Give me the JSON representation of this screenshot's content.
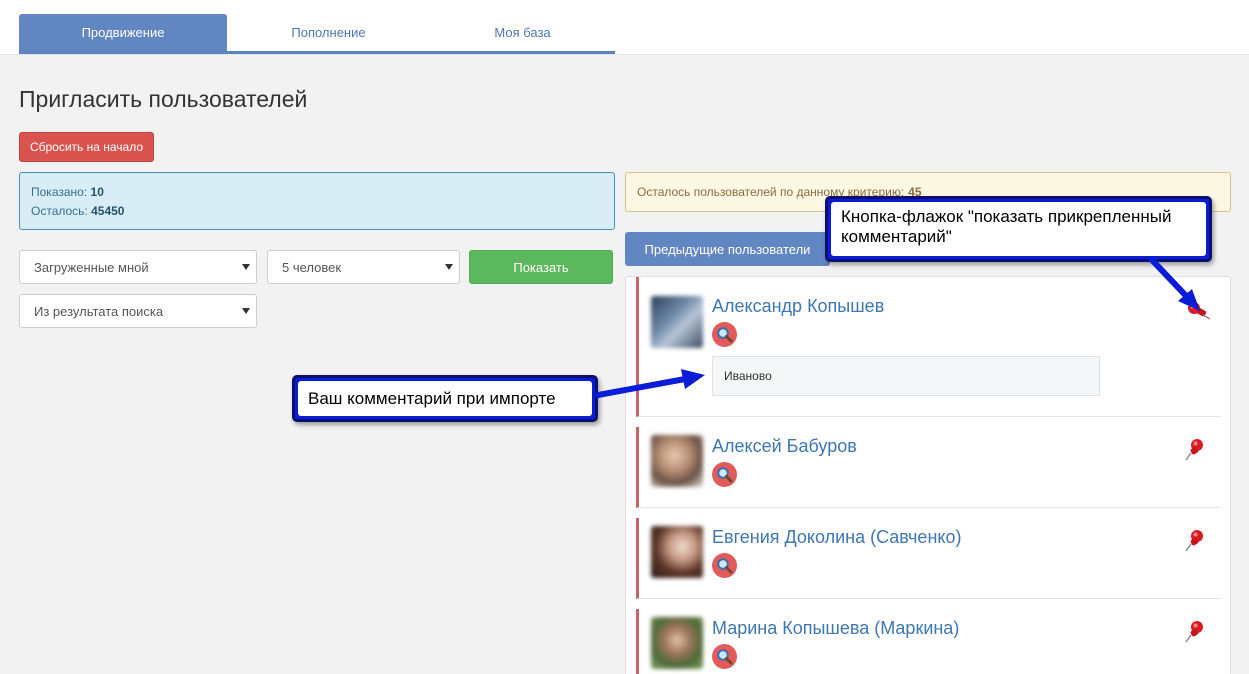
{
  "tabs": [
    {
      "label": "Продвижение",
      "active": true
    },
    {
      "label": "Пополнение",
      "active": false
    },
    {
      "label": "Моя база",
      "active": false
    }
  ],
  "page_title": "Пригласить пользователей",
  "reset_button": "Сбросить на начало",
  "info": {
    "shown_label": "Показано:",
    "shown_value": "10",
    "left_label": "Осталось:",
    "left_value": "45450"
  },
  "filters": {
    "source": "Загруженные мной",
    "count": "5 человек",
    "scope": "Из результата поиска",
    "show_button": "Показать"
  },
  "remaining": {
    "label": "Осталось пользователей по данному критерию:",
    "value": "45"
  },
  "prev_button": "Предыдущие пользователи",
  "users": [
    {
      "name": "Александр Копышев",
      "comment": "Иваново"
    },
    {
      "name": "Алексей Бабуров"
    },
    {
      "name": "Евгения Доколина (Савченко)"
    },
    {
      "name": "Марина Копышева (Маркина)"
    }
  ],
  "callouts": {
    "pin": "Кнопка-флажок \"показать прикрепленный комментарий\"",
    "comment": "Ваш комментарий при импорте"
  },
  "colors": {
    "primary": "#6286c1",
    "danger": "#d9534f",
    "success": "#5cb85c",
    "row_accent": "#c86468",
    "callout": "#0a1cd8"
  },
  "icons": {
    "search": "magnifier-icon",
    "pin": "pushpin-icon"
  }
}
